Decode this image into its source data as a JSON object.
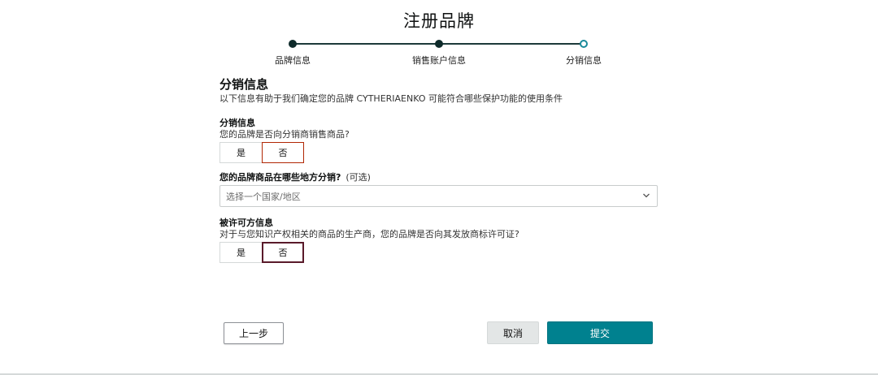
{
  "page": {
    "title": "注册品牌"
  },
  "stepper": {
    "steps": [
      {
        "label": "品牌信息",
        "state": "done"
      },
      {
        "label": "销售账户信息",
        "state": "done"
      },
      {
        "label": "分销信息",
        "state": "current"
      }
    ]
  },
  "section": {
    "title": "分销信息",
    "description": "以下信息有助于我们确定您的品牌 CYTHERIAENKO 可能符合哪些保护功能的使用条件"
  },
  "distribution": {
    "title": "分销信息",
    "question": "您的品牌是否向分销商销售商品?",
    "options": [
      "是",
      "否"
    ],
    "selected": "否"
  },
  "region": {
    "title": "您的品牌商品在哪些地方分销?",
    "optional": "(可选)",
    "placeholder": "选择一个国家/地区"
  },
  "licensee": {
    "title": "被许可方信息",
    "question": "对于与您知识产权相关的商品的生产商，您的品牌是否向其发放商标许可证?",
    "options": [
      "是",
      "否"
    ],
    "selected": "否"
  },
  "actions": {
    "prev_label": "上一步",
    "cancel_label": "取消",
    "submit_label": "提交"
  },
  "colors": {
    "primary_button": "#00818f",
    "step_done": "#0f2b2b",
    "step_current": "#1a8a9a",
    "selected_border": "#b12704"
  },
  "icons": {
    "select_chevron": "chevron-down-icon"
  }
}
